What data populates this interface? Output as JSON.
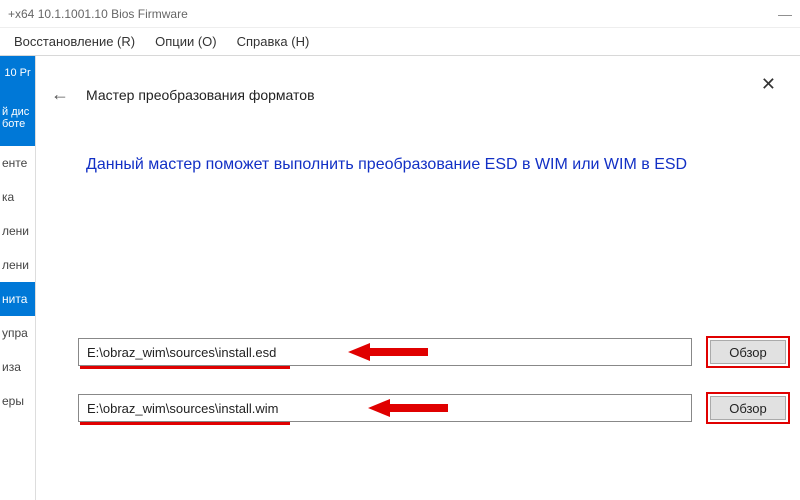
{
  "titlebar": {
    "title": "+x64 10.1.1001.10 Bios Firmware",
    "minimize": "—"
  },
  "menubar": {
    "restore": "Восстановление (R)",
    "options": "Опции (O)",
    "help": "Справка (H)"
  },
  "close_label": "✕",
  "sidebar": {
    "top_blue": "10 Pr",
    "mid_blue_l1": "й дис",
    "mid_blue_l2": "боте",
    "items": [
      "енте",
      "ка",
      "лени",
      "лени",
      "нита",
      "упра",
      "иза",
      "еры"
    ]
  },
  "wizard": {
    "back": "←",
    "title": "Мастер преобразования форматов",
    "intro": "Данный мастер поможет выполнить преобразование ESD в WIM или WIM в ESD"
  },
  "fields": {
    "source_value": "E:\\obraz_wim\\sources\\install.esd",
    "target_value": "E:\\obraz_wim\\sources\\install.wim"
  },
  "buttons": {
    "browse": "Обзор"
  },
  "colors": {
    "accent": "#0078d7",
    "highlight": "#e00000",
    "headline": "#1230c5"
  }
}
